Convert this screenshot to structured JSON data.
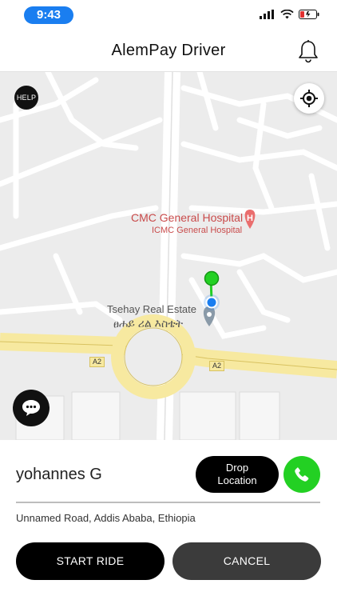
{
  "status_bar": {
    "time": "9:43"
  },
  "header": {
    "title": "AlemPay Driver"
  },
  "map": {
    "help_label": "HELP",
    "hospital_name": "CMC General Hospital",
    "hospital_subtitle": "ICMC General Hospital",
    "estate_name": "Tsehay Real Estate",
    "estate_name_amharic": "ፀሐይ ሪል እስቴት",
    "road_left": "A2",
    "road_right": "A2"
  },
  "ride": {
    "rider_name": "yohannes G",
    "drop_line1": "Drop",
    "drop_line2": "Location",
    "address": "Unnamed Road, Addis Ababa, Ethiopia"
  },
  "actions": {
    "start_label": "START RIDE",
    "cancel_label": "CANCEL"
  },
  "colors": {
    "accent_green": "#23d023",
    "marker_blue": "#1a7ef0",
    "time_pill": "#1a7ef0",
    "road_yellow": "#f7e9a0"
  }
}
